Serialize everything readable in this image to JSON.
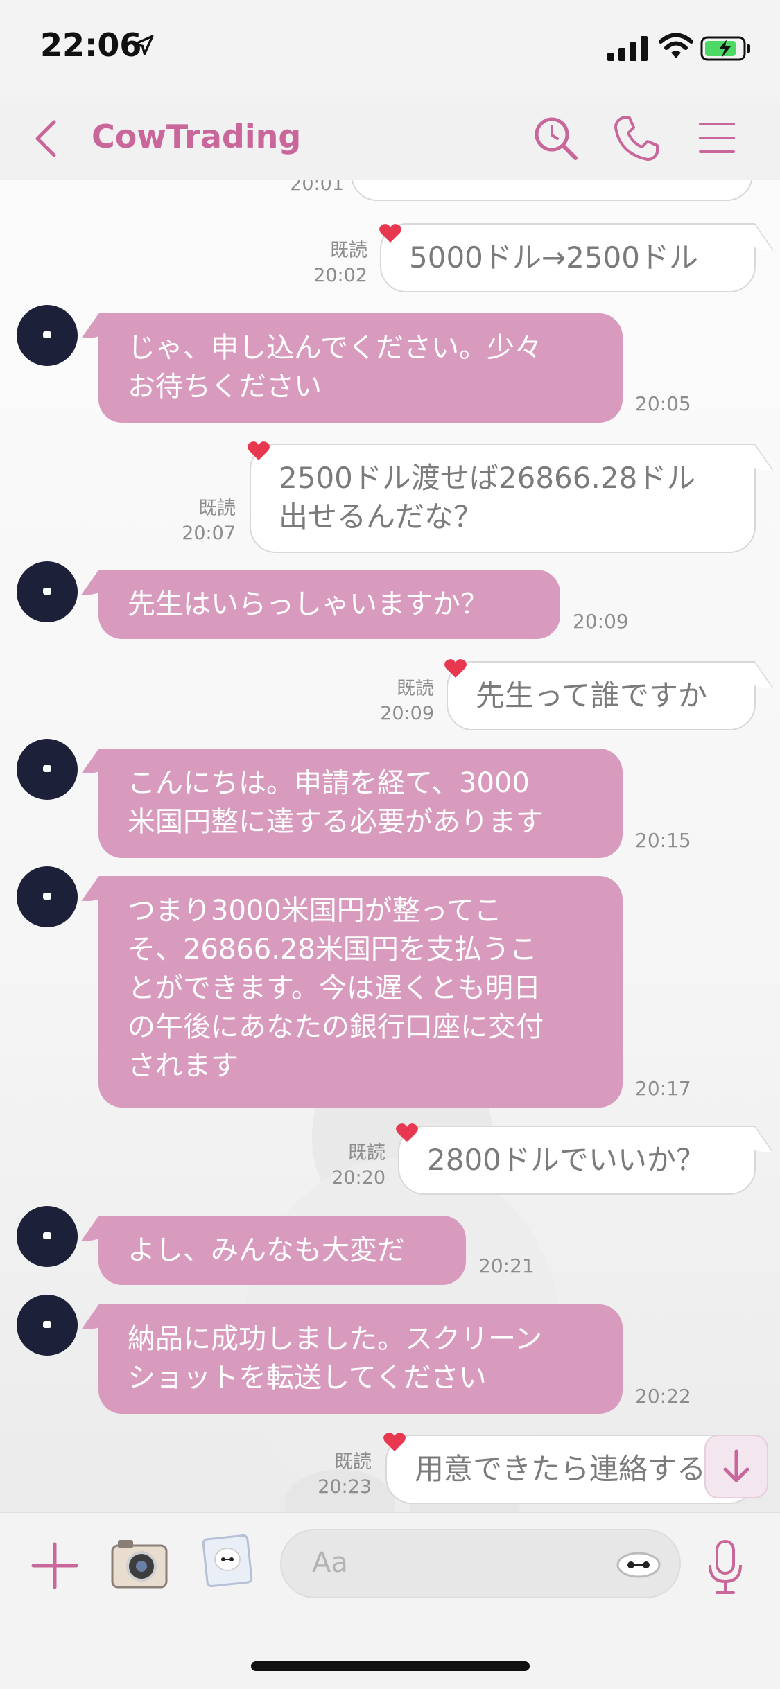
{
  "status_bar": {
    "time": "22:06"
  },
  "header": {
    "title": "CowTrading"
  },
  "messages": {
    "m0": {
      "time": "20:01"
    },
    "m1": {
      "read": "既読",
      "time": "20:02",
      "text": "5000ドル→2500ドル"
    },
    "m2": {
      "line1": "じゃ、申し込んでください。少々",
      "line2": "お待ちください",
      "time": "20:05"
    },
    "m3": {
      "read": "既読",
      "time": "20:07",
      "line1": "2500ドル渡せば26866.28ドル",
      "line2": "出せるんだな？"
    },
    "m4": {
      "text": "先生はいらっしゃいますか？",
      "time": "20:09"
    },
    "m5": {
      "read": "既読",
      "time": "20:09",
      "text": "先生って誰ですか"
    },
    "m6": {
      "line1": "こんにちは。申請を経て、3000",
      "line2": "米国円整に達する必要があります",
      "time": "20:15"
    },
    "m7": {
      "line1": "つまり3000米国円が整ってこ",
      "line2": "そ、26866.28米国円を支払うこ",
      "line3": "とができます。今は遅くとも明日",
      "line4": "の午後にあなたの銀行口座に交付",
      "line5": "されます",
      "time": "20:17"
    },
    "m8": {
      "read": "既読",
      "time": "20:20",
      "text": "2800ドルでいいか？"
    },
    "m9": {
      "text": "よし、みんなも大変だ",
      "time": "20:21"
    },
    "m10": {
      "line1": "納品に成功しました。スクリーン",
      "line2": "ショットを転送してください",
      "time": "20:22"
    },
    "m11": {
      "read": "既読",
      "time": "20:23",
      "text": "用意できたら連絡する"
    }
  },
  "input": {
    "placeholder": "Aa"
  },
  "colors": {
    "accent": "#c9679a",
    "incoming_bubble": "#d99bbd",
    "outgoing_bubble": "#ffffff"
  },
  "icons": [
    "location-arrow-icon",
    "signal-icon",
    "wifi-icon",
    "battery-icon",
    "back-icon",
    "search-icon",
    "phone-icon",
    "menu-icon",
    "heart-icon",
    "chevron-down-icon",
    "plus-icon",
    "camera-icon",
    "photo-icon",
    "sticker-icon",
    "mic-icon"
  ]
}
